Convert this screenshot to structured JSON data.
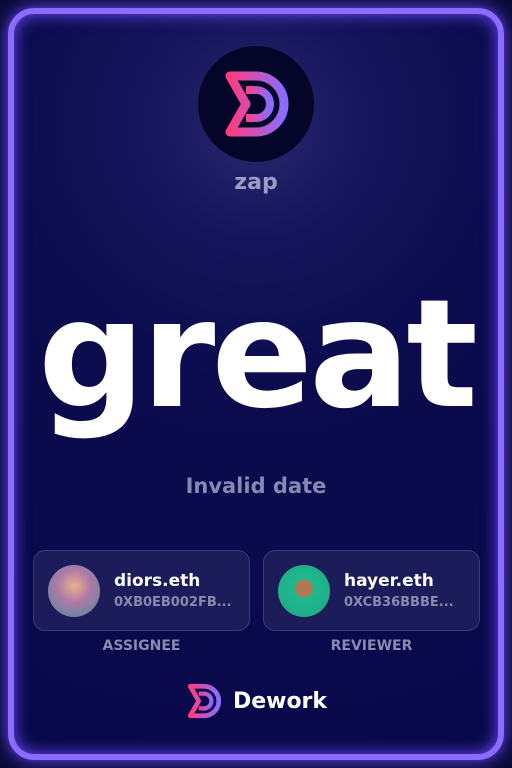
{
  "organization": {
    "name": "zap"
  },
  "task": {
    "title": "great",
    "date": "Invalid date"
  },
  "assignee": {
    "name": "diors.eth",
    "address": "0XB0EB002FB...",
    "role": "ASSIGNEE"
  },
  "reviewer": {
    "name": "hayer.eth",
    "address": "0XCB36BBBE...",
    "role": "REVIEWER"
  },
  "brand": {
    "name": "Dework"
  },
  "colors": {
    "frame": "#8a6cff",
    "pink": "#ff3d7f",
    "purple": "#8a6cff"
  }
}
